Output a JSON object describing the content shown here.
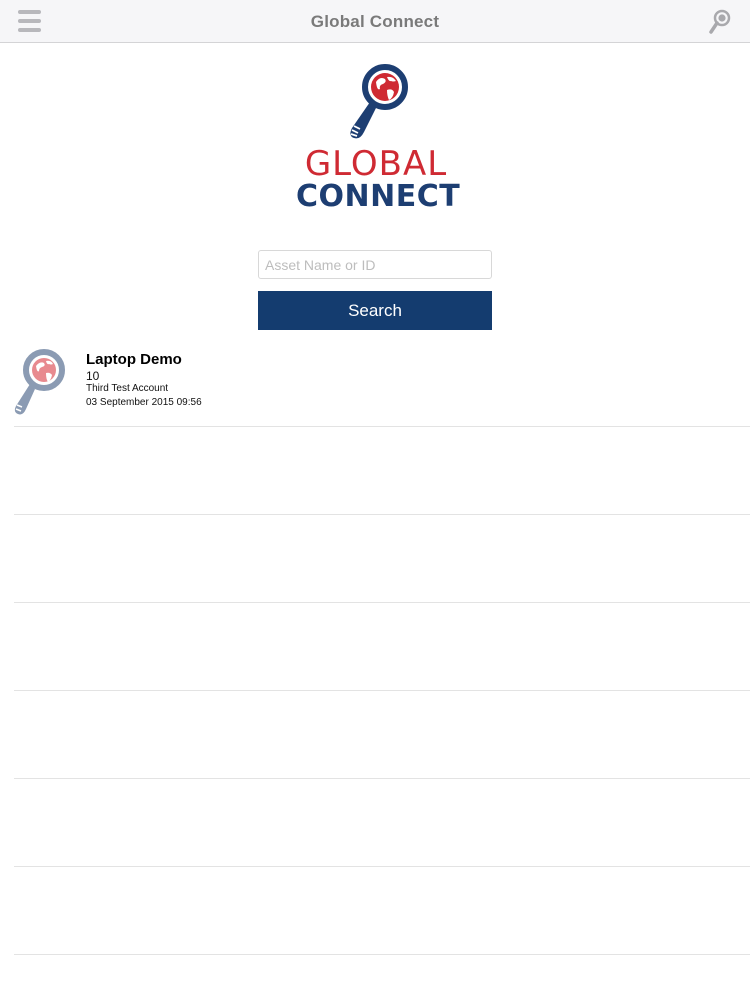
{
  "navbar": {
    "title": "Global Connect",
    "menu_icon": "hamburger-menu-icon",
    "search_icon": "magnifier-search-icon"
  },
  "logo": {
    "line1": "GLOBAL",
    "line2": "CONNECT",
    "colors": {
      "red": "#cf2a33",
      "blue": "#1d3e72"
    }
  },
  "search": {
    "placeholder": "Asset Name or ID",
    "value": "",
    "button_label": "Search"
  },
  "results": [
    {
      "name": "Laptop Demo",
      "id": "10",
      "account": "Third Test Account",
      "date": "03 September 2015 09:56",
      "thumbnail_icon": "globe-magnifier-icon"
    }
  ],
  "theme": {
    "accent": "#143c6f",
    "navbar_bg": "#f6f6f8",
    "divider": "#e3e3e3"
  }
}
